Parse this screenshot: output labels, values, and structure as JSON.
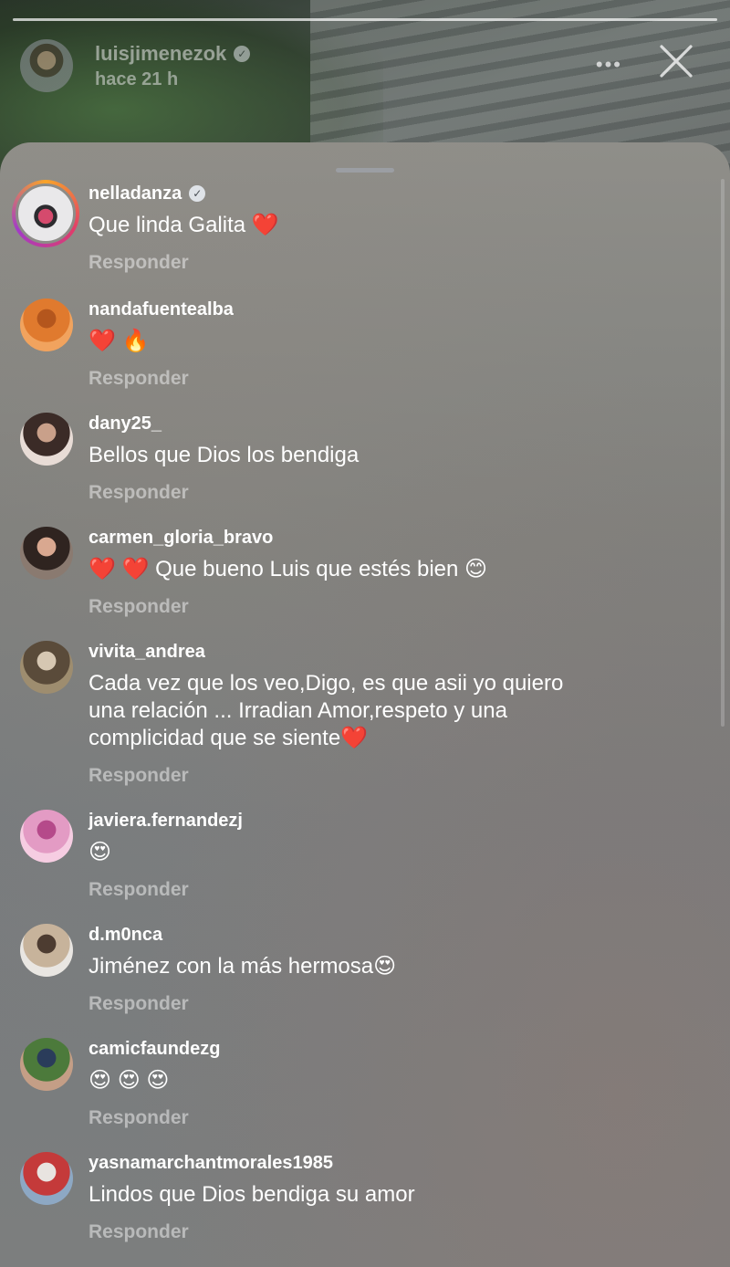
{
  "story": {
    "username": "luisjimenezok",
    "time": "hace 21 h",
    "more_icon": "more-horizontal-icon",
    "close_icon": "close-icon"
  },
  "comments": [
    {
      "username": "nelladanza",
      "verified": true,
      "text": "Que linda Galita ❤️",
      "reply": "Responder",
      "avatar_colors": [
        "#d54a6d",
        "#2c2b2f",
        "#e9e8ea"
      ]
    },
    {
      "username": "nandafuentealba",
      "verified": false,
      "text": "❤️ 🔥",
      "reply": "Responder",
      "avatar_colors": [
        "#e07a2e",
        "#b4561d",
        "#f1a35e"
      ]
    },
    {
      "username": "dany25_",
      "verified": false,
      "text": "Bellos que Dios los bendiga",
      "reply": "Responder",
      "avatar_colors": [
        "#3b2b27",
        "#c9a08a",
        "#e8dcd6"
      ]
    },
    {
      "username": "carmen_gloria_bravo",
      "verified": false,
      "text": "❤️ ❤️ Que bueno Luis que estés bien 😊",
      "reply": "Responder",
      "avatar_colors": [
        "#2f2420",
        "#d9a890",
        "#8a7a70"
      ]
    },
    {
      "username": "vivita_andrea",
      "verified": false,
      "text": "Cada vez que los veo,Digo, es que asii yo quiero\nuna relación ... Irradian Amor,respeto y una\ncomplicidad que se siente❤️",
      "reply": "Responder",
      "avatar_colors": [
        "#5a4b3a",
        "#d6c7b2",
        "#9e8d6f"
      ]
    },
    {
      "username": "javiera.fernandezj",
      "verified": false,
      "text": "😍",
      "reply": "Responder",
      "avatar_colors": [
        "#e39bc4",
        "#b54a8a",
        "#f6cde2"
      ]
    },
    {
      "username": "d.m0nca",
      "verified": false,
      "text": "Jiménez con la más hermosa😍",
      "reply": "Responder",
      "avatar_colors": [
        "#c7b39b",
        "#4d3c31",
        "#e9e6e2"
      ]
    },
    {
      "username": "camicfaundezg",
      "verified": false,
      "text": "😍 😍 😍",
      "reply": "Responder",
      "avatar_colors": [
        "#4c7a3b",
        "#2a3c5a",
        "#c49e86"
      ]
    },
    {
      "username": "yasnamarchantmorales1985",
      "verified": false,
      "text": "Lindos que Dios bendiga su amor",
      "reply": "Responder",
      "avatar_colors": [
        "#c43a3a",
        "#e8e4e0",
        "#8da8c4"
      ]
    }
  ]
}
